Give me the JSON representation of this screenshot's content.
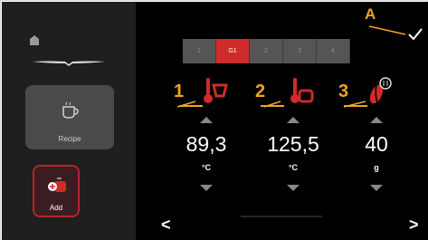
{
  "sidebar": {
    "recipe_label": "Recipe",
    "add_label": "Add"
  },
  "tabs": [
    "1",
    "G1",
    "2",
    "3",
    "4"
  ],
  "active_tab": 1,
  "params": [
    {
      "number": "1",
      "value": "89,3",
      "unit": "°C",
      "icon": "water-temperature-icon"
    },
    {
      "number": "2",
      "value": "125,5",
      "unit": "°C",
      "icon": "steam-temperature-icon"
    },
    {
      "number": "3",
      "value": "40",
      "unit": "g",
      "icon": "coffee-dose-icon"
    }
  ],
  "annotation": {
    "label": "A"
  },
  "nav": {
    "prev": "<",
    "next": ">"
  },
  "colors": {
    "accent": "#cf2b2b",
    "annotation": "#f0a424",
    "sidebar": "#1f1f1f"
  }
}
